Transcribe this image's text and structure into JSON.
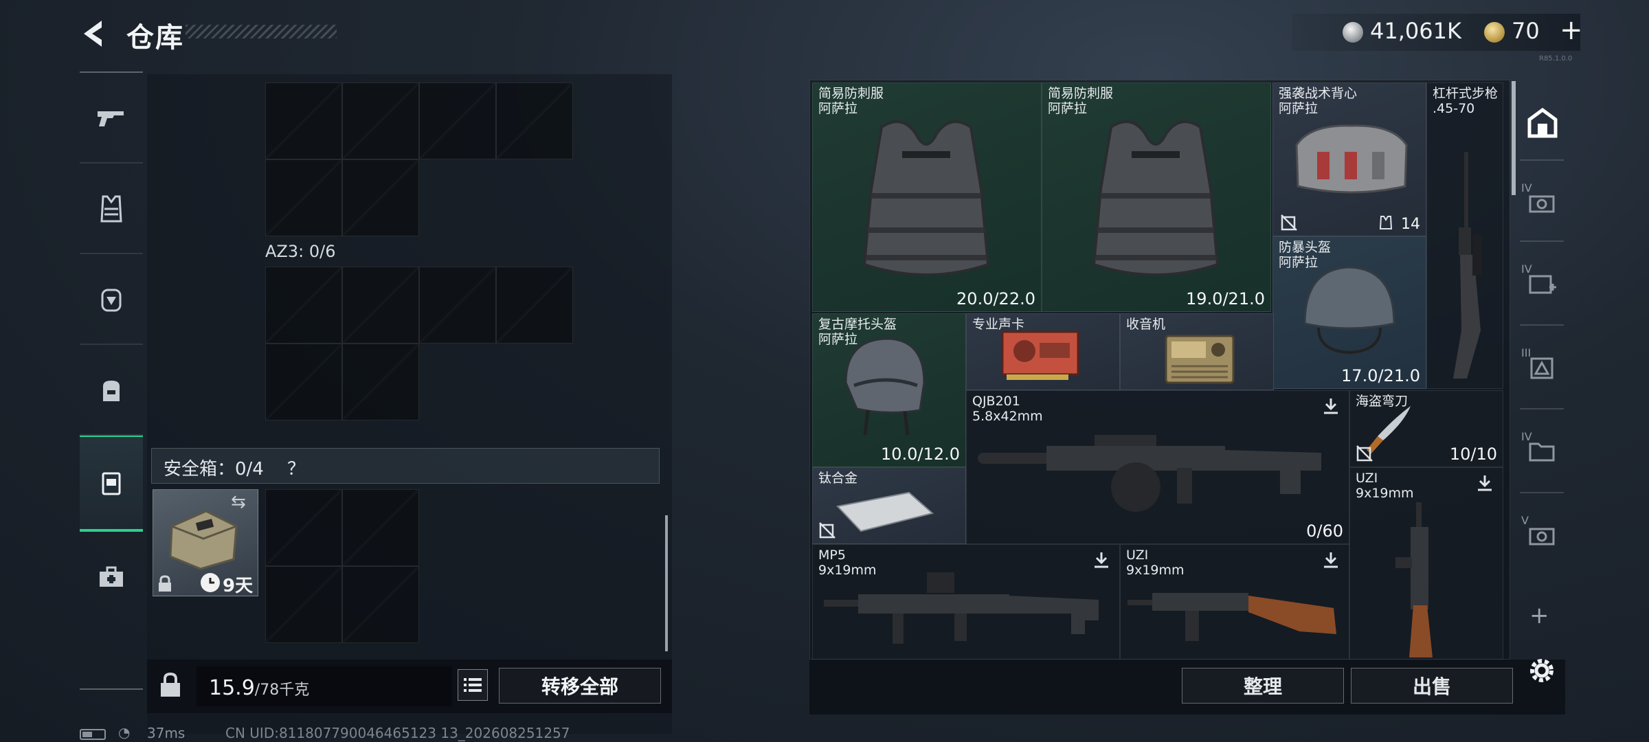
{
  "header": {
    "title": "仓库",
    "silver_amount": "41,061K",
    "gold_amount": "70",
    "plus_label": "+",
    "version": "R85.1.0.0"
  },
  "left_tabs": [
    {
      "name": "weapons",
      "icon": "pistol-icon"
    },
    {
      "name": "armor",
      "icon": "vest-icon"
    },
    {
      "name": "helmet",
      "icon": "helmet-icon"
    },
    {
      "name": "backpack",
      "icon": "backpack-icon"
    },
    {
      "name": "safebox",
      "icon": "safebox-icon",
      "active": true
    },
    {
      "name": "medkit",
      "icon": "medkit-icon"
    }
  ],
  "left": {
    "az3_label": "AZ3: 0/6",
    "safebox_label": "安全箱：0/4",
    "safebox_help": "？",
    "safebox_days": "9天",
    "weight_value": "15.9",
    "weight_max": "/78千克",
    "transfer_all": "转移全部"
  },
  "inventory": {
    "items": [
      {
        "id": "vest1",
        "name": "简易防刺服",
        "sub": "阿萨拉",
        "durability": "20.0/22.0"
      },
      {
        "id": "vest2",
        "name": "简易防刺服",
        "sub": "阿萨拉",
        "durability": "19.0/21.0"
      },
      {
        "id": "tactical-vest",
        "name": "强袭战术背心",
        "sub": "阿萨拉",
        "count": "14"
      },
      {
        "id": "lever-rifle",
        "name": "杠杆式步枪",
        "sub": ".45-70"
      },
      {
        "id": "riot-helmet",
        "name": "防暴头盔",
        "sub": "阿萨拉",
        "durability": "17.0/21.0"
      },
      {
        "id": "moto-helmet",
        "name": "复古摩托头盔",
        "sub": "阿萨拉",
        "durability": "10.0/12.0"
      },
      {
        "id": "gpu",
        "name": "专业声卡"
      },
      {
        "id": "radio",
        "name": "收音机"
      },
      {
        "id": "qjb201",
        "name": "QJB201",
        "sub": "5.8x42mm",
        "ammo": "0/60"
      },
      {
        "id": "pirate-knife",
        "name": "海盗弯刀",
        "count": "10/10"
      },
      {
        "id": "titanium",
        "name": "钛合金"
      },
      {
        "id": "uzi-right",
        "name": "UZI",
        "sub": "9x19mm"
      },
      {
        "id": "mp5",
        "name": "MP5",
        "sub": "9x19mm"
      },
      {
        "id": "uzi-bottom",
        "name": "UZI",
        "sub": "9x19mm"
      }
    ]
  },
  "right_tabs": [
    {
      "label": "",
      "icon": "home-icon"
    },
    {
      "label": "IV",
      "icon": "camera-icon"
    },
    {
      "label": "IV",
      "icon": "medkit-plus-icon"
    },
    {
      "label": "III",
      "icon": "triangle-box-icon"
    },
    {
      "label": "IV",
      "icon": "folder-icon"
    },
    {
      "label": "V",
      "icon": "camera-icon"
    }
  ],
  "right_add": "+",
  "buttons": {
    "sort": "整理",
    "sell": "出售"
  },
  "status": {
    "ping": "37ms",
    "uid": "CN UID:811807790046465123 13_202608251257"
  },
  "colors": {
    "accent": "#2ad18e"
  }
}
